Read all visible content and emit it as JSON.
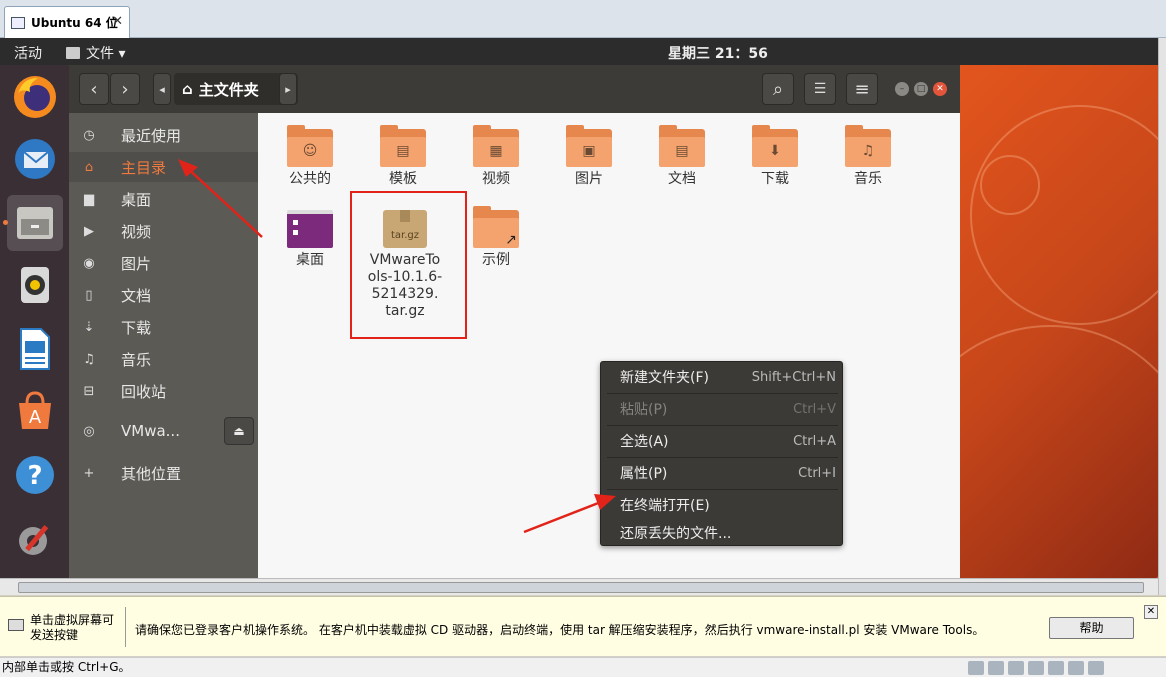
{
  "host": {
    "tab_title": "Ubuntu 64 位",
    "tab_close": "✕"
  },
  "topbar": {
    "activities": "活动",
    "app_menu": "文件 ▾",
    "clock": "星期三 21：56"
  },
  "dock": {
    "items": [
      {
        "name": "firefox"
      },
      {
        "name": "thunderbird"
      },
      {
        "name": "files"
      },
      {
        "name": "rhythmbox"
      },
      {
        "name": "writer"
      },
      {
        "name": "software"
      },
      {
        "name": "help"
      },
      {
        "name": "settings"
      }
    ]
  },
  "headerbar": {
    "back": "‹",
    "forward": "›",
    "path_left": "◂",
    "path_right": "▸",
    "crumb": "主文件夹",
    "home_glyph": "⌂",
    "search": "⌕",
    "view": "☰",
    "menu": "≡"
  },
  "sidebar": {
    "items": [
      {
        "icon": "◷",
        "label": "最近使用"
      },
      {
        "icon": "⌂",
        "label": "主目录"
      },
      {
        "icon": "▆",
        "label": "桌面"
      },
      {
        "icon": "▶",
        "label": "视频"
      },
      {
        "icon": "◉",
        "label": "图片"
      },
      {
        "icon": "▯",
        "label": "文档"
      },
      {
        "icon": "⇣",
        "label": "下载"
      },
      {
        "icon": "♫",
        "label": "音乐"
      },
      {
        "icon": "⊟",
        "label": "回收站"
      },
      {
        "icon": "◎",
        "label": "VMwa..."
      },
      {
        "icon": "+",
        "label": "其他位置"
      }
    ],
    "eject": "⏏"
  },
  "files": [
    {
      "name": "公共的",
      "emblem": "☺"
    },
    {
      "name": "模板",
      "emblem": "▤"
    },
    {
      "name": "视频",
      "emblem": "▦"
    },
    {
      "name": "图片",
      "emblem": "▣"
    },
    {
      "name": "文档",
      "emblem": "▤"
    },
    {
      "name": "下载",
      "emblem": "⬇"
    },
    {
      "name": "音乐",
      "emblem": "♫"
    },
    {
      "name": "桌面",
      "emblem": ""
    },
    {
      "name": "VMwareTools-10.1.6-5214329.tar.gz",
      "name_lines": [
        "VMwareTo",
        "ols-10.1.6-",
        "5214329.",
        "tar.gz"
      ],
      "emblem": "tar.gz"
    },
    {
      "name": "示例",
      "emblem": "↗"
    }
  ],
  "context_menu": {
    "items": [
      {
        "label": "新建文件夹(F)",
        "shortcut": "Shift+Ctrl+N"
      },
      {
        "label": "粘贴(P)",
        "shortcut": "Ctrl+V"
      },
      {
        "label": "全选(A)",
        "shortcut": "Ctrl+A"
      },
      {
        "label": "属性(P)",
        "shortcut": "Ctrl+I"
      },
      {
        "label": "在终端打开(E)",
        "shortcut": ""
      },
      {
        "label": "还原丢失的文件...",
        "shortcut": ""
      }
    ]
  },
  "hint_bar": {
    "left": "单击虚拟屏幕可发送按键",
    "message": "请确保您已登录客户机操作系统。 在客户机中装载虚拟 CD 驱动器，启动终端，使用 tar 解压缩安装程序，然后执行 vmware-install.pl 安装 VMware Tools。",
    "help": "帮助",
    "close": "✕"
  },
  "status_bar": {
    "text": "内部单击或按 Ctrl+G。"
  },
  "colors": {
    "accent": "#f07a3e",
    "annotation_red": "#e2231a"
  }
}
